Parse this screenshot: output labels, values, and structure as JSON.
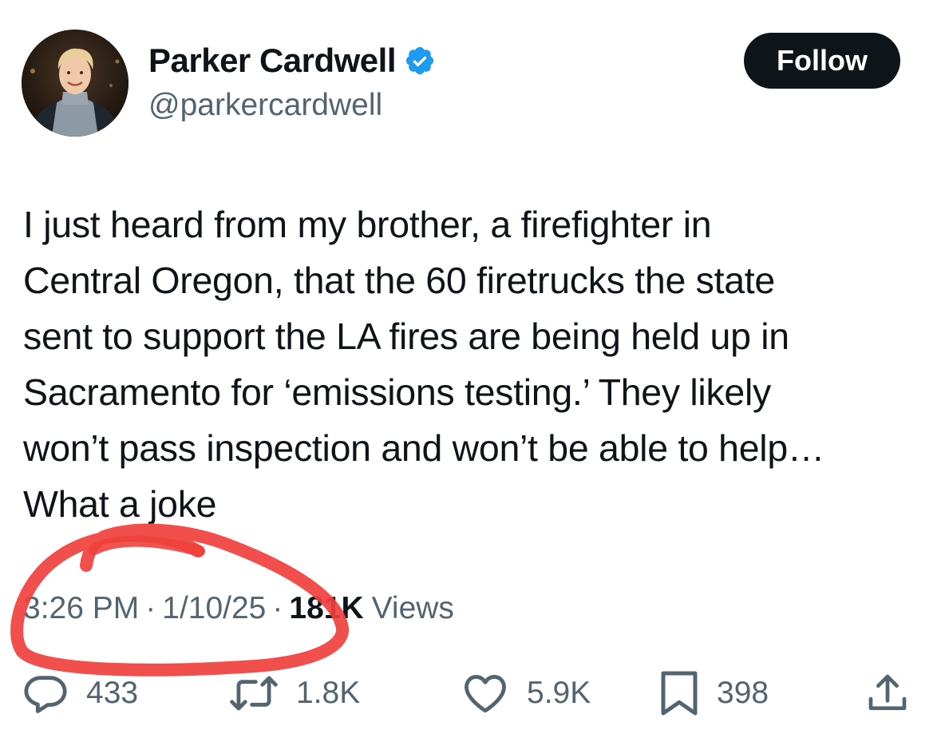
{
  "author": {
    "display_name": "Parker Cardwell",
    "handle": "@parkercardwell",
    "verified": true,
    "verified_badge_color": "#1d9bf0"
  },
  "follow_button": {
    "label": "Follow"
  },
  "tweet": {
    "lines": [
      "I just heard from my brother, a firefighter in",
      "Central Oregon, that the 60 firetrucks the state",
      "sent to support the LA fires are being held up in",
      "Sacramento for ‘emissions testing.’ They likely",
      "won’t pass inspection and won’t be able to help…",
      "What a joke"
    ]
  },
  "meta": {
    "time": "3:26 PM",
    "separator": "·",
    "date": "1/10/25",
    "views_count": "181K",
    "views_label": "Views"
  },
  "annotation": {
    "type": "hand-drawn red circle around timestamp and views",
    "color": "#f0403c"
  },
  "actions": {
    "reply": {
      "icon": "reply-icon",
      "count": "433"
    },
    "repost": {
      "icon": "repost-icon",
      "count": "1.8K"
    },
    "like": {
      "icon": "heart-icon",
      "count": "5.9K"
    },
    "bookmark": {
      "icon": "bookmark-icon",
      "count": "398"
    },
    "share": {
      "icon": "share-icon"
    }
  },
  "colors": {
    "text_primary": "#0f1419",
    "text_secondary": "#536471",
    "follow_bg": "#0f1419",
    "follow_text": "#ffffff"
  }
}
